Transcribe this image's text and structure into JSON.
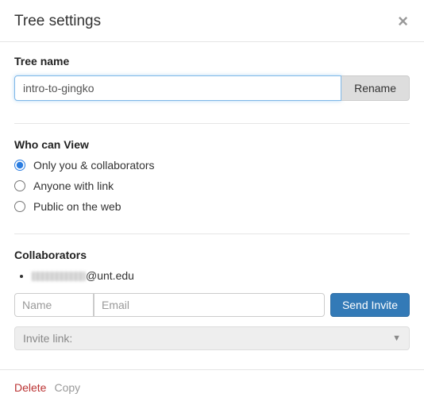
{
  "header": {
    "title": "Tree settings"
  },
  "treeName": {
    "label": "Tree name",
    "value": "intro-to-gingko",
    "renameLabel": "Rename"
  },
  "visibility": {
    "label": "Who can View",
    "options": [
      {
        "label": "Only you & collaborators",
        "selected": true
      },
      {
        "label": "Anyone with link",
        "selected": false
      },
      {
        "label": "Public on the web",
        "selected": false
      }
    ]
  },
  "collaborators": {
    "label": "Collaborators",
    "items": [
      {
        "emailSuffix": "@unt.edu"
      }
    ],
    "namePlaceholder": "Name",
    "emailPlaceholder": "Email",
    "sendInviteLabel": "Send Invite",
    "inviteLinkLabel": "Invite link:"
  },
  "footer": {
    "deleteLabel": "Delete",
    "copyLabel": "Copy"
  }
}
